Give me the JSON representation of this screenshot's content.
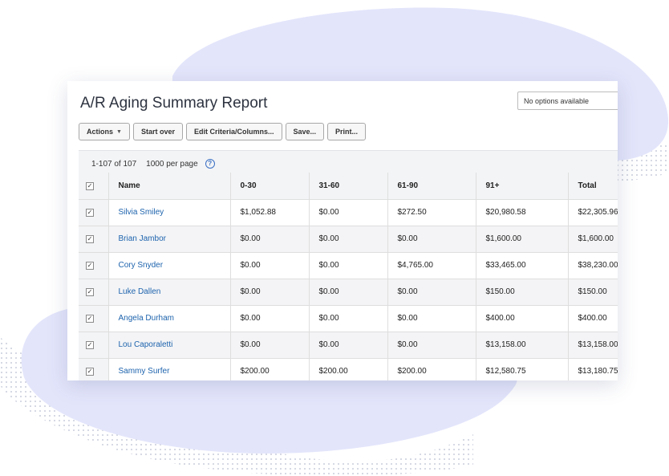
{
  "report": {
    "title": "A/R Aging Summary Report",
    "options_placeholder": "No options available"
  },
  "toolbar": {
    "actions_label": "Actions",
    "start_over_label": "Start over",
    "edit_label": "Edit Criteria/Columns...",
    "save_label": "Save...",
    "print_label": "Print..."
  },
  "pager": {
    "range": "1-107 of 107",
    "per_page": "1000 per page",
    "help_glyph": "?"
  },
  "table": {
    "columns": [
      "Name",
      "0-30",
      "31-60",
      "61-90",
      "91+",
      "Total"
    ],
    "check_glyph": "✓",
    "rows": [
      {
        "name": "Silvia Smiley",
        "c0_30": "$1,052.88",
        "c31_60": "$0.00",
        "c61_90": "$272.50",
        "c91": "$20,980.58",
        "total": "$22,305.96"
      },
      {
        "name": "Brian Jambor",
        "c0_30": "$0.00",
        "c31_60": "$0.00",
        "c61_90": "$0.00",
        "c91": "$1,600.00",
        "total": "$1,600.00"
      },
      {
        "name": "Cory Snyder",
        "c0_30": "$0.00",
        "c31_60": "$0.00",
        "c61_90": "$4,765.00",
        "c91": "$33,465.00",
        "total": "$38,230.00"
      },
      {
        "name": "Luke Dallen",
        "c0_30": "$0.00",
        "c31_60": "$0.00",
        "c61_90": "$0.00",
        "c91": "$150.00",
        "total": "$150.00"
      },
      {
        "name": "Angela Durham",
        "c0_30": "$0.00",
        "c31_60": "$0.00",
        "c61_90": "$0.00",
        "c91": "$400.00",
        "total": "$400.00"
      },
      {
        "name": "Lou Caporaletti",
        "c0_30": "$0.00",
        "c31_60": "$0.00",
        "c61_90": "$0.00",
        "c91": "$13,158.00",
        "total": "$13,158.00"
      },
      {
        "name": "Sammy Surfer",
        "c0_30": "$200.00",
        "c31_60": "$200.00",
        "c61_90": "$200.00",
        "c91": "$12,580.75",
        "total": "$13,180.75"
      }
    ]
  },
  "colors": {
    "blob": "#e3e5fb",
    "dots": "#b9bdd0",
    "link": "#1d63ad",
    "text": "#2d3340"
  }
}
